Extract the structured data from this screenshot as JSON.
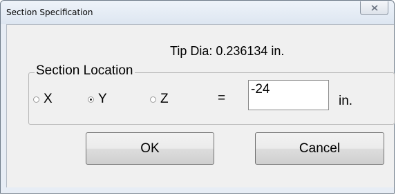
{
  "window": {
    "title": "Section Specification",
    "close_icon": "close-icon"
  },
  "tip_dia": "Tip Dia: 0.236134 in.",
  "section_location": {
    "legend": "Section Location",
    "options": [
      {
        "label": "X",
        "checked": false
      },
      {
        "label": "Y",
        "checked": true
      },
      {
        "label": "Z",
        "checked": false
      }
    ],
    "equals": "=",
    "value": "-24",
    "units": "in."
  },
  "buttons": {
    "ok": "OK",
    "cancel": "Cancel"
  }
}
